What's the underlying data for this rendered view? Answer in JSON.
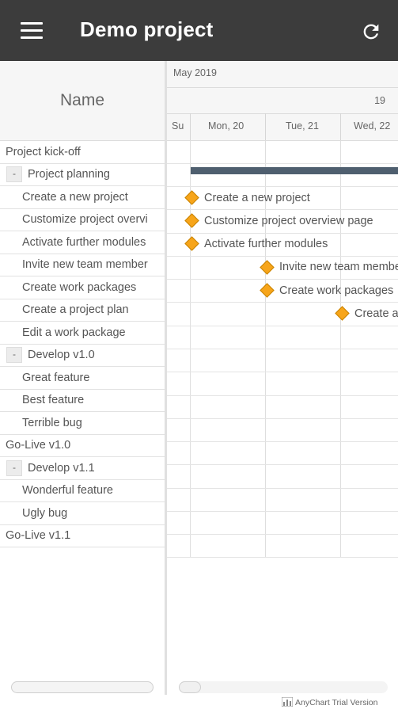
{
  "app": {
    "title": "Demo project",
    "menu_icon": "menu-icon",
    "refresh_icon": "refresh-icon",
    "header_color": "#3c3c3c"
  },
  "grid": {
    "name_header": "Name",
    "rows": [
      {
        "label": "Project kick-off",
        "level": 0
      },
      {
        "label": "Project planning",
        "level": "group",
        "collapse": "-"
      },
      {
        "label": "Create a new project",
        "level": 1
      },
      {
        "label": "Customize project overvi",
        "level": 1
      },
      {
        "label": "Activate further modules",
        "level": 1
      },
      {
        "label": "Invite new team member",
        "level": 1
      },
      {
        "label": "Create work packages",
        "level": 1
      },
      {
        "label": "Create a project plan",
        "level": 1
      },
      {
        "label": "Edit a work package",
        "level": 1
      },
      {
        "label": "Develop v1.0",
        "level": "group",
        "collapse": "-"
      },
      {
        "label": "Great feature",
        "level": 1
      },
      {
        "label": "Best feature",
        "level": 1
      },
      {
        "label": "Terrible bug",
        "level": 1
      },
      {
        "label": "Go-Live v1.0",
        "level": 0
      },
      {
        "label": "Develop v1.1",
        "level": "group",
        "collapse": "-"
      },
      {
        "label": "Wonderful feature",
        "level": 1
      },
      {
        "label": "Ugly bug",
        "level": 1
      },
      {
        "label": "Go-Live v1.1",
        "level": 0
      }
    ]
  },
  "timeline": {
    "month": "May 2019",
    "week": "19",
    "days": [
      "Su",
      "Mon, 20",
      "Tue, 21",
      "Wed, 22"
    ],
    "milestone_labels": [
      "Create a new project",
      "Customize project overview page",
      "Activate further modules",
      "Invite new team member",
      "Create work packages",
      "Create a project plan"
    ],
    "milestone_color": "#f7a51a",
    "summary_bar_color": "#4f5f6f"
  },
  "watermark": "AnyChart Trial Version"
}
